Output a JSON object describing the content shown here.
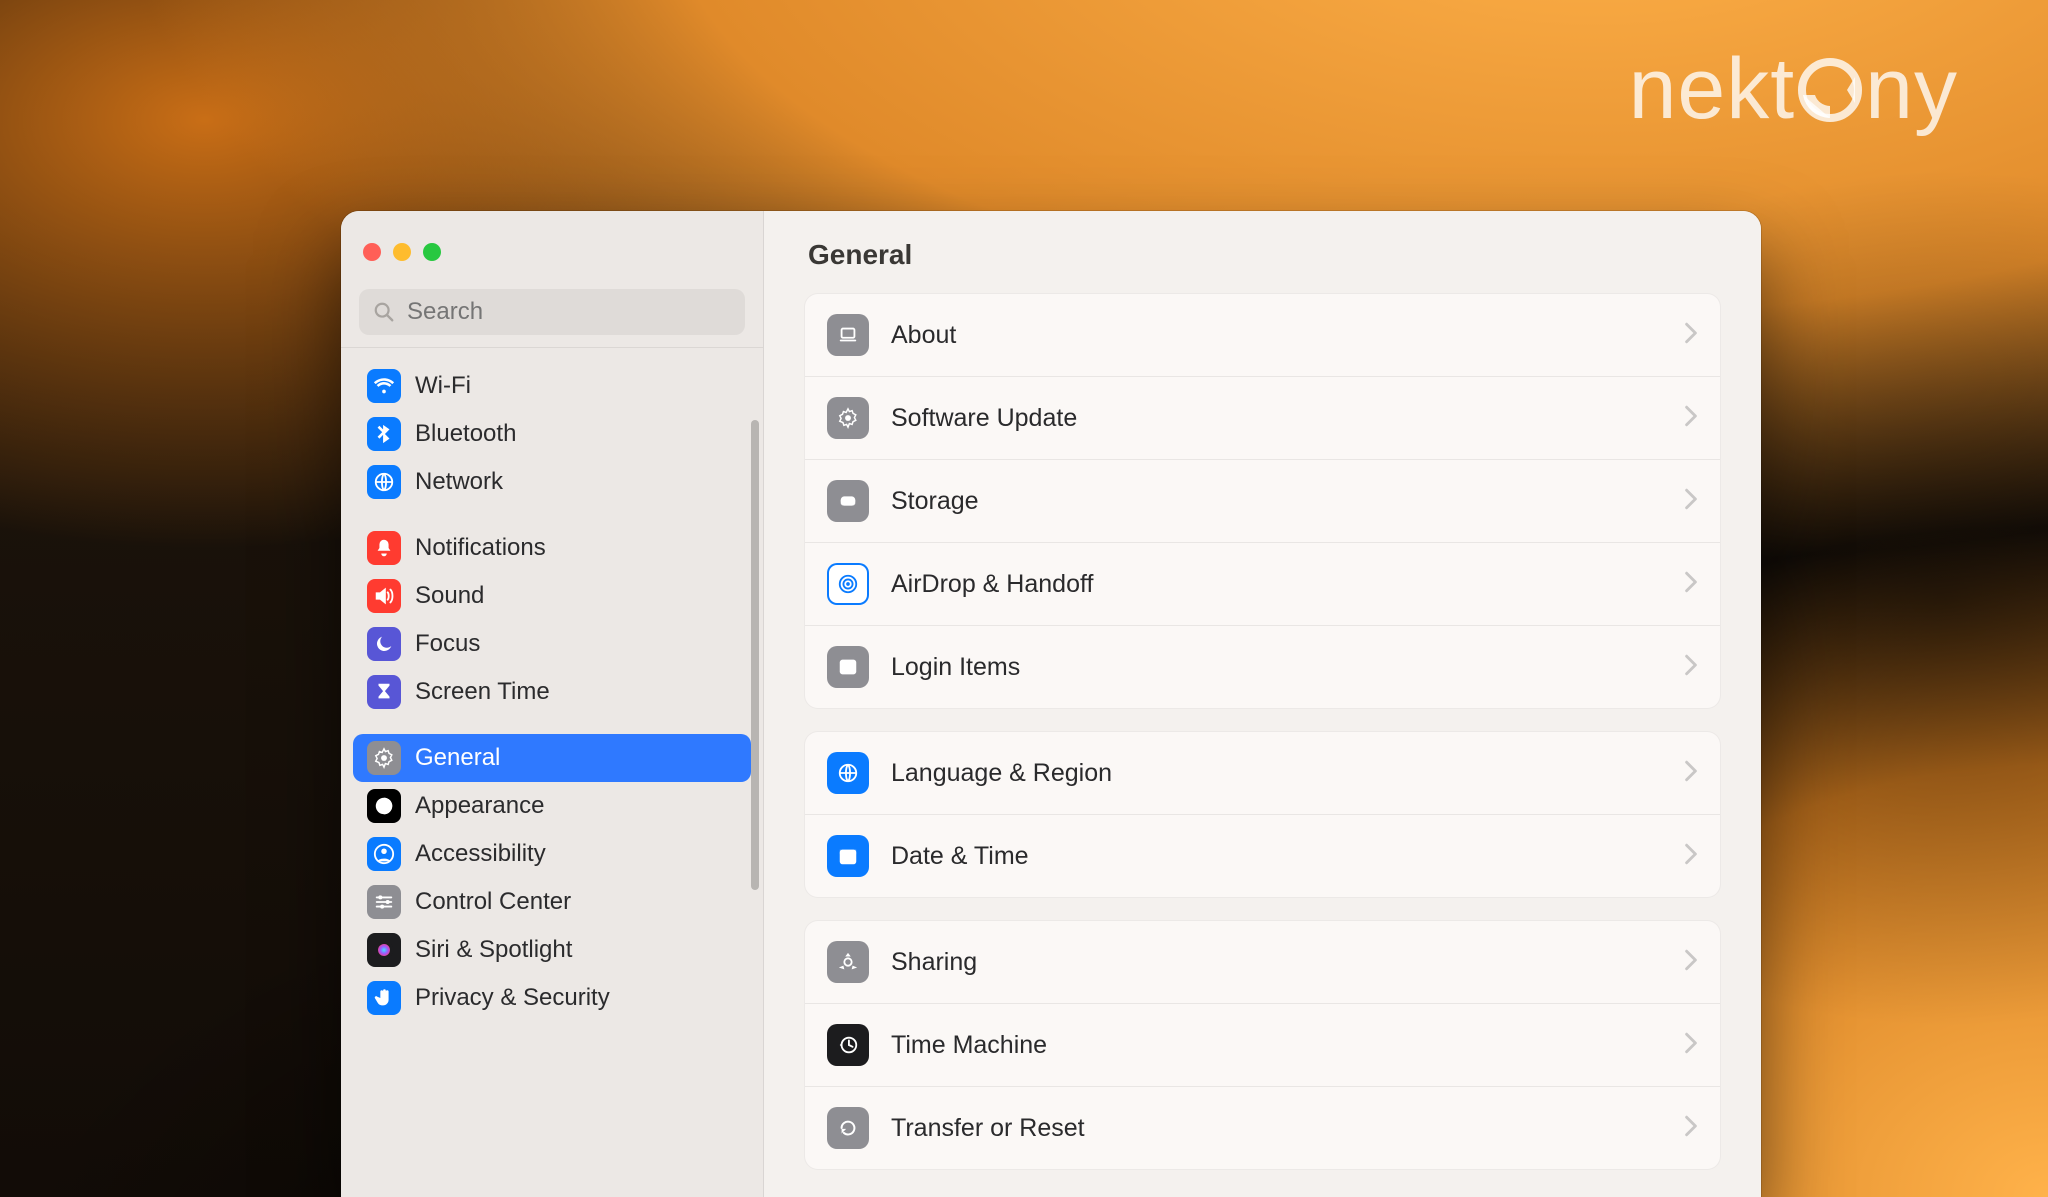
{
  "brand": "nektony",
  "search": {
    "placeholder": "Search"
  },
  "contentTitle": "General",
  "sidebar": {
    "groups": [
      {
        "items": [
          {
            "id": "wifi",
            "label": "Wi-Fi",
            "icon": "wifi",
            "color": "#0a7bff"
          },
          {
            "id": "bluetooth",
            "label": "Bluetooth",
            "icon": "bluetooth",
            "color": "#0a7bff"
          },
          {
            "id": "network",
            "label": "Network",
            "icon": "globe",
            "color": "#0a7bff"
          }
        ]
      },
      {
        "items": [
          {
            "id": "notifications",
            "label": "Notifications",
            "icon": "bell",
            "color": "#ff3b30"
          },
          {
            "id": "sound",
            "label": "Sound",
            "icon": "speaker",
            "color": "#ff3b30"
          },
          {
            "id": "focus",
            "label": "Focus",
            "icon": "moon",
            "color": "#5856d6"
          },
          {
            "id": "screentime",
            "label": "Screen Time",
            "icon": "hourglass",
            "color": "#5856d6"
          }
        ]
      },
      {
        "items": [
          {
            "id": "general",
            "label": "General",
            "icon": "gear",
            "color": "#8e8e93",
            "selected": true
          },
          {
            "id": "appearance",
            "label": "Appearance",
            "icon": "contrast",
            "color": "#000000"
          },
          {
            "id": "accessibility",
            "label": "Accessibility",
            "icon": "person",
            "color": "#0a7bff"
          },
          {
            "id": "controlcenter",
            "label": "Control Center",
            "icon": "sliders",
            "color": "#8e8e93"
          },
          {
            "id": "siri",
            "label": "Siri & Spotlight",
            "icon": "siri",
            "color": "#1c1c1e"
          },
          {
            "id": "privacy",
            "label": "Privacy & Security",
            "icon": "hand",
            "color": "#0a7bff"
          }
        ]
      }
    ]
  },
  "content": {
    "cards": [
      {
        "rows": [
          {
            "id": "about",
            "label": "About",
            "icon": "laptop",
            "color": "#8e8e93"
          },
          {
            "id": "swupdate",
            "label": "Software Update",
            "icon": "gear",
            "color": "#8e8e93"
          },
          {
            "id": "storage",
            "label": "Storage",
            "icon": "disk",
            "color": "#8e8e93"
          },
          {
            "id": "airdrop",
            "label": "AirDrop & Handoff",
            "icon": "airdrop",
            "color": "#ffffff",
            "ring": "#0a7bff"
          },
          {
            "id": "login",
            "label": "Login Items",
            "icon": "list",
            "color": "#8e8e93"
          }
        ]
      },
      {
        "rows": [
          {
            "id": "language",
            "label": "Language & Region",
            "icon": "globe",
            "color": "#0a7bff"
          },
          {
            "id": "datetime",
            "label": "Date & Time",
            "icon": "calendar",
            "color": "#0a7bff"
          }
        ]
      },
      {
        "rows": [
          {
            "id": "sharing",
            "label": "Sharing",
            "icon": "share",
            "color": "#8e8e93"
          },
          {
            "id": "timemachine",
            "label": "Time Machine",
            "icon": "clockback",
            "color": "#1c1c1e"
          },
          {
            "id": "transfer",
            "label": "Transfer or Reset",
            "icon": "reset",
            "color": "#8e8e93"
          }
        ]
      }
    ]
  }
}
